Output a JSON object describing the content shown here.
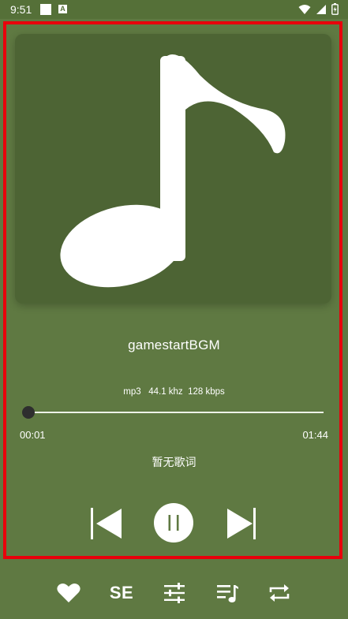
{
  "status_bar": {
    "time": "9:51",
    "icons": [
      "notification-square-icon",
      "app-a-icon",
      "wifi-icon",
      "signal-icon",
      "battery-icon"
    ]
  },
  "player": {
    "song_title": "gamestartBGM",
    "audio_info": "mp3   44.1 khz  128 kbps",
    "current_time": "00:01",
    "total_time": "01:44",
    "progress": 0.01,
    "lyrics": "暂无歌词",
    "state": "playing"
  },
  "controls": {
    "previous": "skip-previous-icon",
    "play_pause": "pause-icon",
    "next": "skip-next-icon"
  },
  "bottom_bar": {
    "favorite": "heart-icon",
    "sound_effect_label": "SE",
    "equalizer": "equalizer-sliders-icon",
    "playlist": "playlist-icon",
    "repeat": "repeat-icon"
  },
  "colors": {
    "background": "#5f7942",
    "status_bar": "#557038",
    "album_card": "#4d6434",
    "highlight_frame": "#e8000b"
  }
}
